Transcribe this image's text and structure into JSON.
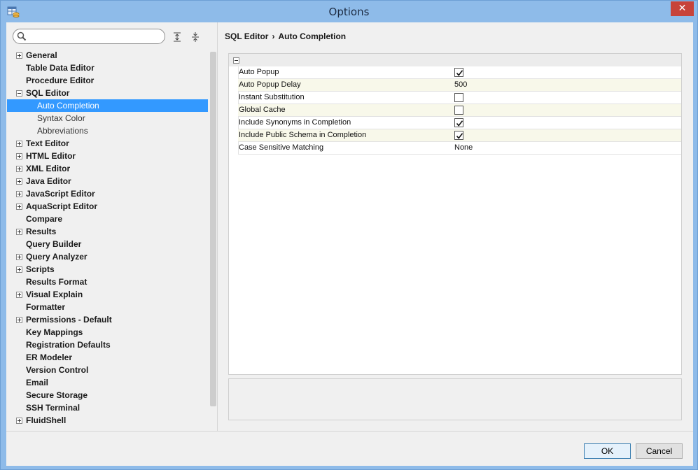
{
  "window": {
    "title": "Options",
    "close_glyph": "✕"
  },
  "search": {
    "placeholder": "",
    "value": ""
  },
  "tree": [
    {
      "label": "General",
      "level": 0,
      "toggle": "plus"
    },
    {
      "label": "Table Data Editor",
      "level": 0,
      "toggle": "none"
    },
    {
      "label": "Procedure Editor",
      "level": 0,
      "toggle": "none"
    },
    {
      "label": "SQL Editor",
      "level": 0,
      "toggle": "minus"
    },
    {
      "label": "Auto Completion",
      "level": 1,
      "toggle": "none",
      "selected": true
    },
    {
      "label": "Syntax Color",
      "level": 1,
      "toggle": "none"
    },
    {
      "label": "Abbreviations",
      "level": 1,
      "toggle": "none"
    },
    {
      "label": "Text Editor",
      "level": 0,
      "toggle": "plus"
    },
    {
      "label": "HTML Editor",
      "level": 0,
      "toggle": "plus"
    },
    {
      "label": "XML Editor",
      "level": 0,
      "toggle": "plus"
    },
    {
      "label": "Java Editor",
      "level": 0,
      "toggle": "plus"
    },
    {
      "label": "JavaScript Editor",
      "level": 0,
      "toggle": "plus"
    },
    {
      "label": "AquaScript Editor",
      "level": 0,
      "toggle": "plus"
    },
    {
      "label": "Compare",
      "level": 0,
      "toggle": "none"
    },
    {
      "label": "Results",
      "level": 0,
      "toggle": "plus"
    },
    {
      "label": "Query Builder",
      "level": 0,
      "toggle": "none"
    },
    {
      "label": "Query Analyzer",
      "level": 0,
      "toggle": "plus"
    },
    {
      "label": "Scripts",
      "level": 0,
      "toggle": "plus"
    },
    {
      "label": "Results Format",
      "level": 0,
      "toggle": "none"
    },
    {
      "label": "Visual Explain",
      "level": 0,
      "toggle": "plus"
    },
    {
      "label": "Formatter",
      "level": 0,
      "toggle": "none"
    },
    {
      "label": "Permissions - Default",
      "level": 0,
      "toggle": "plus"
    },
    {
      "label": "Key Mappings",
      "level": 0,
      "toggle": "none"
    },
    {
      "label": "Registration Defaults",
      "level": 0,
      "toggle": "none"
    },
    {
      "label": "ER Modeler",
      "level": 0,
      "toggle": "none"
    },
    {
      "label": "Version Control",
      "level": 0,
      "toggle": "none"
    },
    {
      "label": "Email",
      "level": 0,
      "toggle": "none"
    },
    {
      "label": "Secure Storage",
      "level": 0,
      "toggle": "none"
    },
    {
      "label": "SSH Terminal",
      "level": 0,
      "toggle": "none"
    },
    {
      "label": "FluidShell",
      "level": 0,
      "toggle": "plus"
    }
  ],
  "breadcrumb": {
    "parent": "SQL Editor",
    "separator": "›",
    "current": "Auto Completion"
  },
  "properties": [
    {
      "name": "Auto Popup",
      "type": "checkbox",
      "checked": true
    },
    {
      "name": "Auto Popup Delay",
      "type": "text",
      "value": "500"
    },
    {
      "name": "Instant Substitution",
      "type": "checkbox",
      "checked": false
    },
    {
      "name": "Global Cache",
      "type": "checkbox",
      "checked": false
    },
    {
      "name": "Include Synonyms in Completion",
      "type": "checkbox",
      "checked": true
    },
    {
      "name": "Include Public Schema in Completion",
      "type": "checkbox",
      "checked": true
    },
    {
      "name": "Case Sensitive Matching",
      "type": "text",
      "value": "None"
    }
  ],
  "footer": {
    "ok_label": "OK",
    "cancel_label": "Cancel"
  },
  "icons": {
    "app": "app-database-icon",
    "search": "search-icon",
    "expand_all": "expand-all-icon",
    "collapse_all": "collapse-all-icon"
  },
  "colors": {
    "titlebar": "#8ebbe9",
    "close": "#c7433a",
    "selection": "#3399ff",
    "row_alt": "#f8f8ea"
  }
}
